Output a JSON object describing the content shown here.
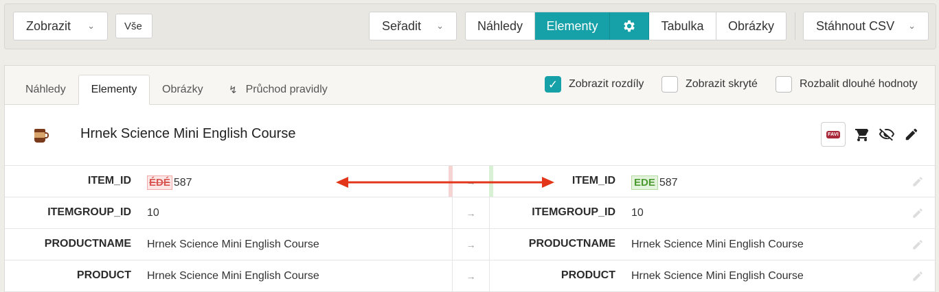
{
  "toolbar": {
    "zobrazit_label": "Zobrazit",
    "vse_label": "Vše",
    "seradit_label": "Seřadit",
    "views": [
      "Náhledy",
      "Elementy",
      "Tabulka",
      "Obrázky"
    ],
    "csv_label": "Stáhnout CSV",
    "accent": "#16a0a8"
  },
  "tabs": [
    "Náhledy",
    "Elementy",
    "Obrázky",
    "Průchod pravidly"
  ],
  "options": {
    "rozdily": "Zobrazit rozdíly",
    "skryte": "Zobrazit skryté",
    "rozbalit": "Rozbalit dlouhé hodnoty",
    "rozdily_checked": true,
    "skryte_checked": false,
    "rozbalit_checked": false
  },
  "product": {
    "title": "Hrnek Science Mini English Course",
    "favi_label": "FAVI"
  },
  "rows": [
    {
      "label": "ITEM_ID",
      "left_removed": "ÉDÉ",
      "left_value": "587",
      "right_added": "EDE",
      "right_value": "587"
    },
    {
      "label": "ITEMGROUP_ID",
      "left_value": "10",
      "right_value": "10"
    },
    {
      "label": "PRODUCTNAME",
      "left_value": "Hrnek Science Mini English Course",
      "right_value": "Hrnek Science Mini English Course"
    },
    {
      "label": "PRODUCT",
      "left_value": "Hrnek Science Mini English Course",
      "right_value": "Hrnek Science Mini English Course"
    }
  ]
}
